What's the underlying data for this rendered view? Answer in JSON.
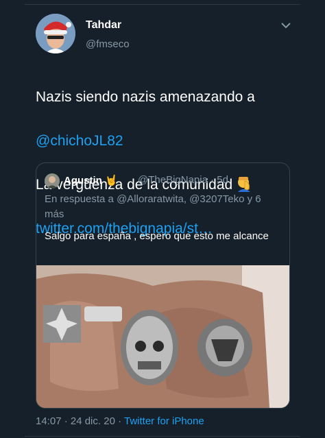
{
  "author": {
    "display_name": "Tahdar",
    "handle": "@fmseco",
    "avatar_icon": "user-avatar-santa-hat"
  },
  "tweet": {
    "line1": "Nazis siendo nazis amenazando a",
    "mention": "@chichoJL82",
    "line3": "La vergüenza de la comunidad",
    "emoji_icon": "face-palm-emoji",
    "link": "twitter.com/thebignapia/st…"
  },
  "quoted": {
    "display_name": "Agustin 🤘",
    "handle": "@TheBigNapia · 5d",
    "reply_prefix": "En respuesta a ",
    "reply_mentions": "@Alloraratwita, @3207Teko",
    "reply_suffix": " y 6 más",
    "text": "Salgo para españa , espero que esto me alcance",
    "media_icon": "photo-hand-with-skull-rings"
  },
  "footer": {
    "time": "14:07 · 24 dic. 20 · ",
    "source": "Twitter for iPhone"
  },
  "colors": {
    "background": "#15202b",
    "link": "#1da1f2",
    "secondary_text": "#8899a6",
    "border": "#38444d"
  }
}
